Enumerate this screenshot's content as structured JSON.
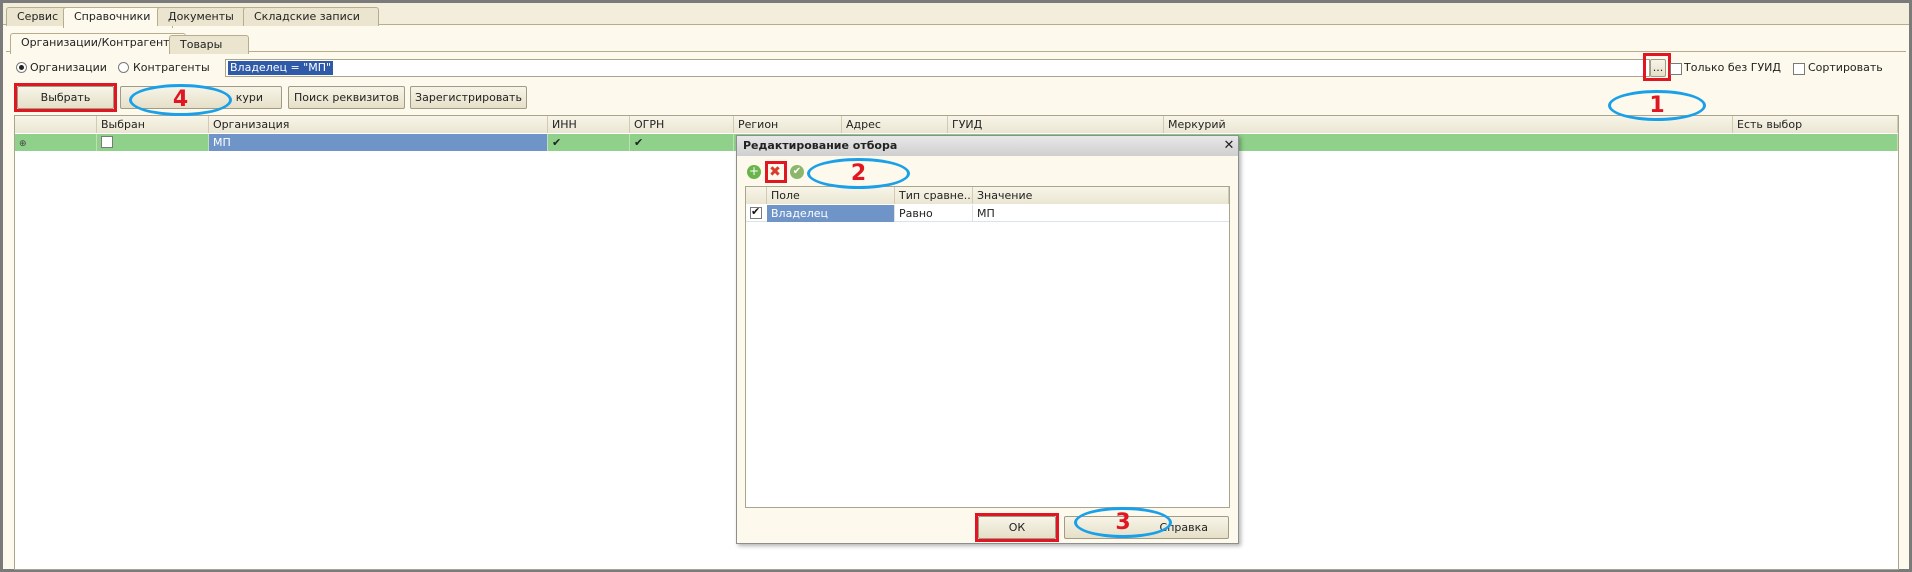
{
  "top_tabs": [
    {
      "label": "Сервис"
    },
    {
      "label": "Справочники",
      "active": true
    },
    {
      "label": "Документы"
    },
    {
      "label": "Складские записи"
    }
  ],
  "sub_tabs": [
    {
      "label": "Организации/Контрагенты",
      "active": true
    },
    {
      "label": "Товары"
    }
  ],
  "filter": {
    "radio_org": "Организации",
    "radio_contr": "Контрагенты",
    "selected": "Организации",
    "filter_value": "Владелец = \"МП\"",
    "dots_label": "...",
    "only_no_guid_label": "Только без ГУИД",
    "only_no_guid_checked": false,
    "sort_label": "Сортировать",
    "sort_checked": false
  },
  "toolbar": {
    "select_label": "Выбрать",
    "mercury_label": "кури",
    "search_label": "Поиск реквизитов",
    "register_label": "Зарегистрировать"
  },
  "grid": {
    "columns": [
      "",
      "Выбран",
      "Организация",
      "ИНН",
      "ОГРН",
      "Регион",
      "Адрес",
      "ГУИД",
      "Меркурий",
      "Есть выбор"
    ],
    "rows": [
      {
        "selected": false,
        "org": "МП",
        "inn_check": true,
        "ogrn_check": true
      }
    ]
  },
  "dialog": {
    "title": "Редактирование отбора",
    "columns": [
      "Поле",
      "Тип сравне...",
      "Значение"
    ],
    "rows": [
      {
        "enabled": true,
        "field": "Владелец",
        "compare": "Равно",
        "value": "МП"
      }
    ],
    "ok_label": "ОК",
    "help_label": "Справка"
  },
  "annotations": [
    "1",
    "2",
    "3",
    "4"
  ],
  "colors": {
    "row_green": "#8fd18a",
    "org_selected_blue": "#6f95c8",
    "annotation_red": "#e01622",
    "annotation_blue": "#1aa0e8"
  }
}
